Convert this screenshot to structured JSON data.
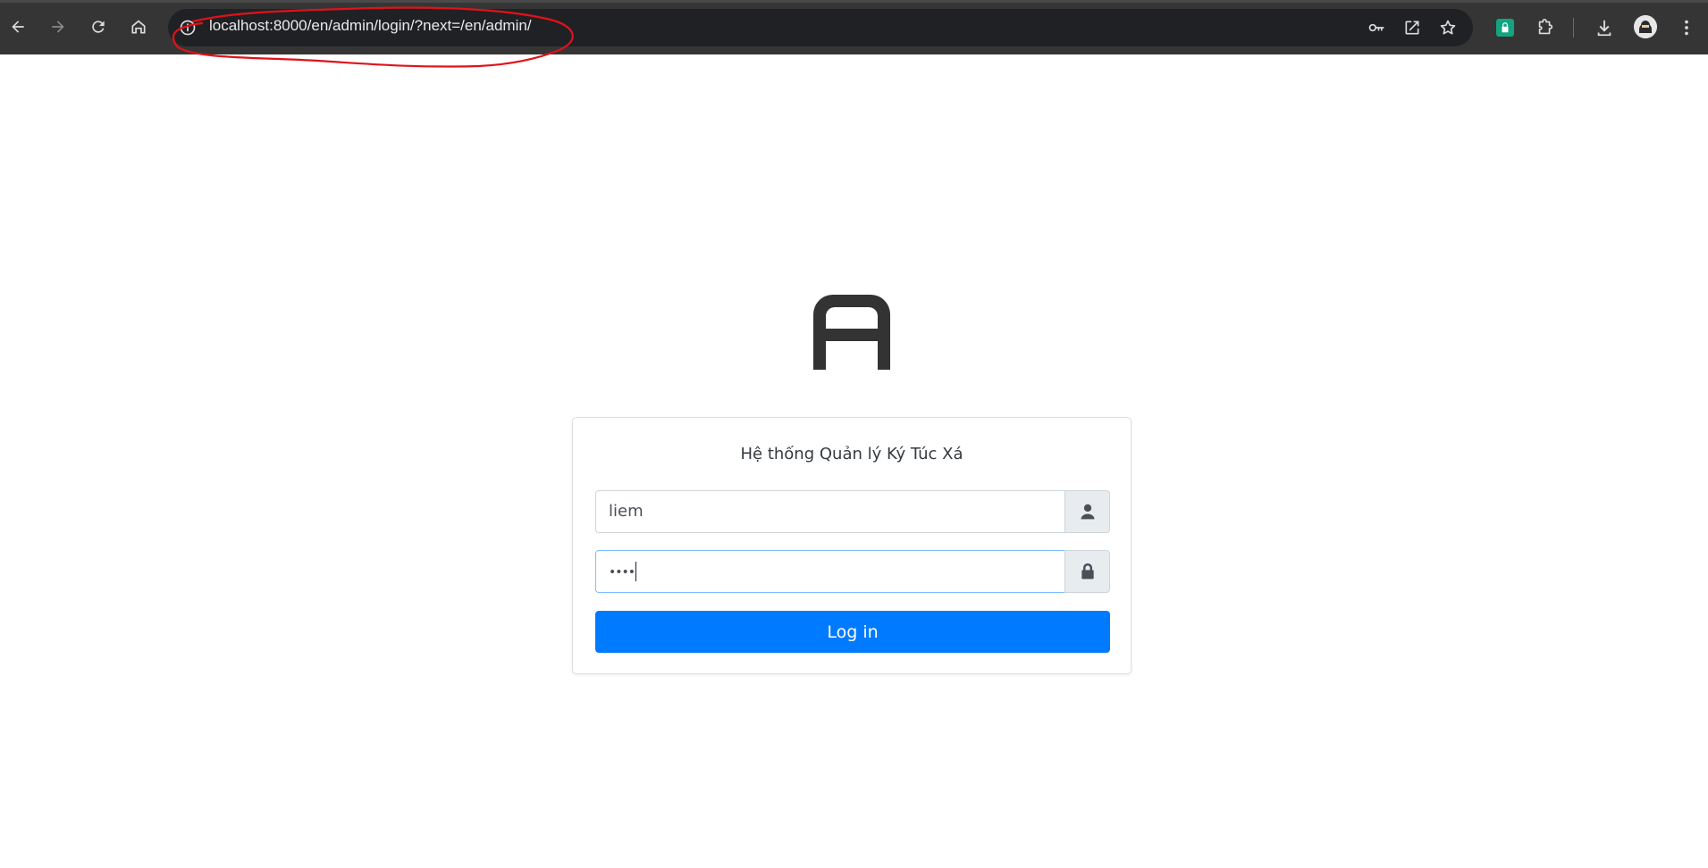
{
  "browser": {
    "url": "localhost:8000/en/admin/login/?next=/en/admin/",
    "annotation_color": "#e0121a"
  },
  "login": {
    "title": "Hệ thống Quản lý Ký Túc Xá",
    "username_value": "liem",
    "password_value": "••••",
    "submit_label": "Log in",
    "button_color": "#007bff"
  },
  "icons": {
    "back": "arrow-left-icon",
    "forward": "arrow-right-icon",
    "reload": "reload-icon",
    "home": "home-icon",
    "site_info": "info-icon",
    "password_key": "key-icon",
    "open_in_app": "external-link-icon",
    "bookmark": "star-icon",
    "extension_lock": "lock-icon",
    "extensions": "puzzle-icon",
    "downloads": "download-icon",
    "profile": "avatar",
    "menu": "kebab-menu-icon",
    "username_addon": "user-icon",
    "password_addon": "lock-icon",
    "logo": "logo-a-icon"
  }
}
